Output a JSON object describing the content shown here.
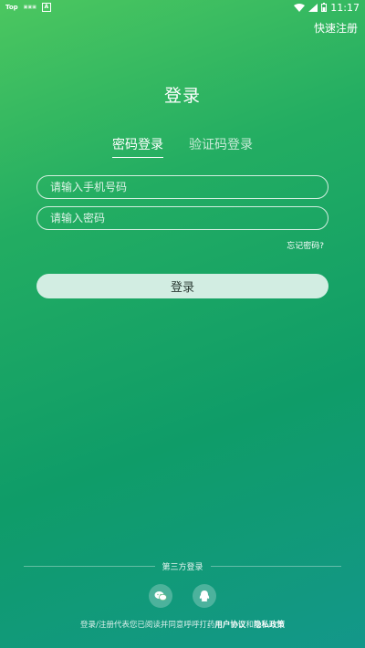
{
  "status_bar": {
    "carrier": "Top",
    "mini_label": "▣▣▣",
    "app_badge": "A",
    "time": "11:17"
  },
  "header": {
    "quick_register": "快速注册",
    "title": "登录"
  },
  "tabs": [
    {
      "label": "密码登录",
      "active": true
    },
    {
      "label": "验证码登录",
      "active": false
    }
  ],
  "form": {
    "phone_placeholder": "请输入手机号码",
    "phone_value": "",
    "password_placeholder": "请输入密码",
    "password_value": "",
    "forgot_label": "忘记密码?",
    "login_label": "登录"
  },
  "footer": {
    "third_party_label": "第三方登录",
    "social": [
      {
        "icon": "wechat-icon"
      },
      {
        "icon": "qq-icon"
      }
    ],
    "agreement_prefix": "登录/注册代表您已阅读并同意呼呼打药",
    "user_agreement": "用户协议",
    "conjunction": "和",
    "privacy_policy": "隐私政策"
  }
}
